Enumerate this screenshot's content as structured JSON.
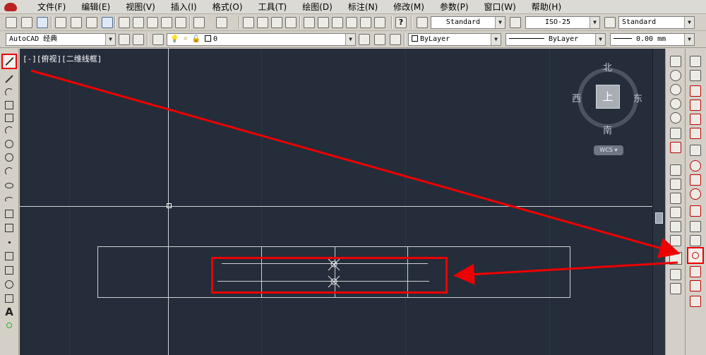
{
  "menu": {
    "items": [
      "文件(F)",
      "编辑(E)",
      "视图(V)",
      "插入(I)",
      "格式(O)",
      "工具(T)",
      "绘图(D)",
      "标注(N)",
      "修改(M)",
      "参数(P)",
      "窗口(W)",
      "帮助(H)"
    ]
  },
  "toolbar": {
    "text_style": "Standard",
    "dim_style": "ISO-25",
    "table_style": "Standard",
    "workspace": "AutoCAD 经典",
    "layer": "0",
    "color": "ByLayer",
    "linetype": "ByLayer",
    "lineweight": "0.00 mm"
  },
  "viewport": {
    "label": "[-][俯视][二维线框]"
  },
  "viewcube": {
    "north": "北",
    "south": "南",
    "east": "东",
    "west": "西",
    "top": "上",
    "wcs": "WCS"
  },
  "colors": {
    "canvas": "#252d3a",
    "highlight": "#e00000",
    "geometry": "#cfd2d6"
  },
  "icons": {
    "left_palette": [
      "line-icon",
      "construction-line-icon",
      "polyline-icon",
      "polygon-icon",
      "rectangle-icon",
      "arc-icon",
      "circle-icon",
      "revision-cloud-icon",
      "spline-icon",
      "ellipse-icon",
      "ellipse-arc-icon",
      "insert-block-icon",
      "make-block-icon",
      "point-icon",
      "hatch-icon",
      "gradient-icon",
      "region-icon",
      "table-icon",
      "multiline-text-icon",
      "add-selected-icon"
    ],
    "highlighted_draw_tool": "line-icon",
    "highlighted_snap_tool": "snap-to-center-icon"
  }
}
